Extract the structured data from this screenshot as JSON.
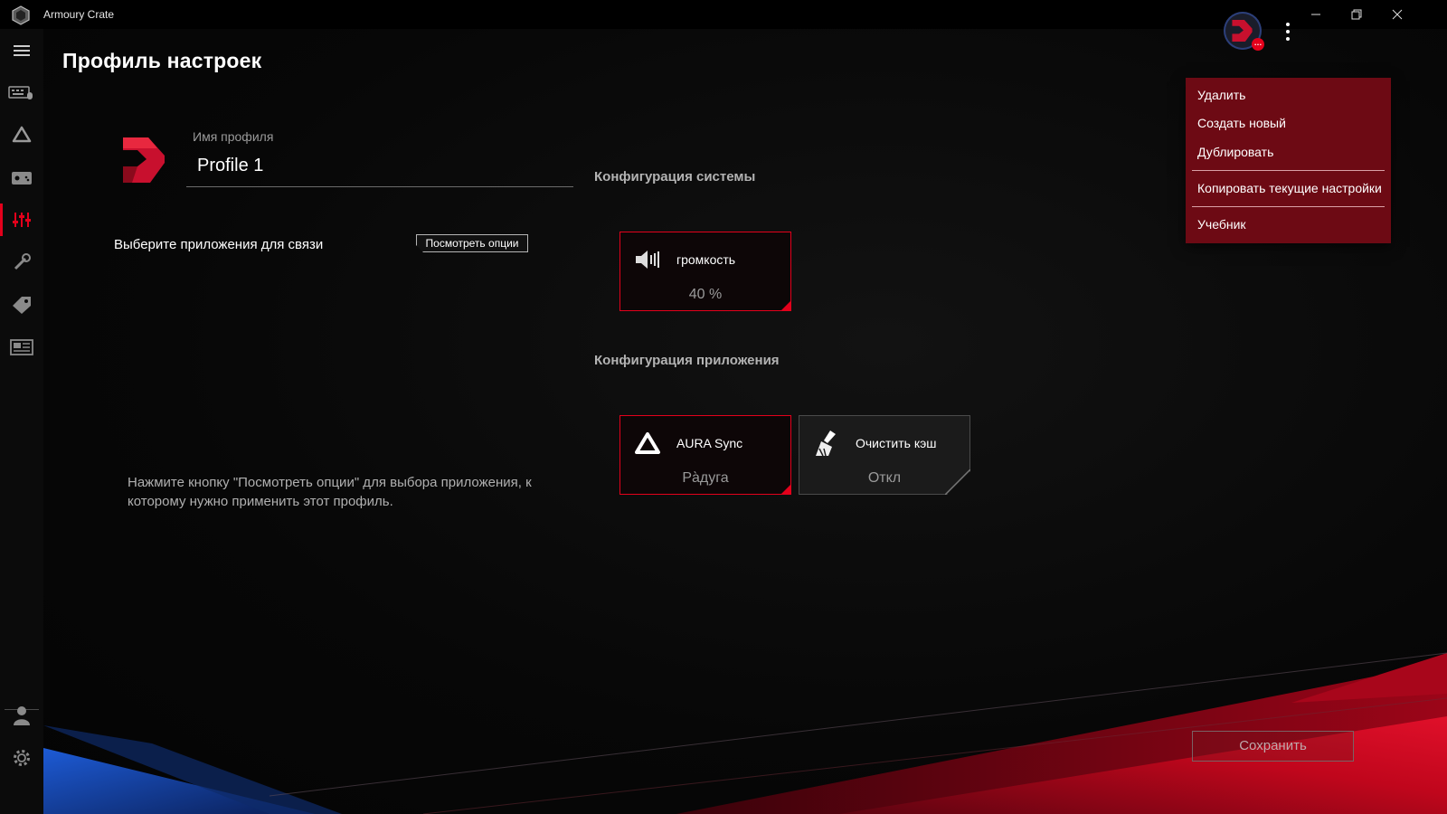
{
  "window": {
    "title": "Armoury Crate"
  },
  "sidebar": {
    "items": [
      {
        "icon": "menu-icon"
      },
      {
        "icon": "keyboard-device-icon"
      },
      {
        "icon": "aura-icon"
      },
      {
        "icon": "gamepad-icon"
      },
      {
        "icon": "scenario-profiles-icon",
        "active": true
      },
      {
        "icon": "tools-icon"
      },
      {
        "icon": "deals-tag-icon"
      },
      {
        "icon": "news-icon"
      },
      {
        "icon": "user-icon"
      },
      {
        "icon": "settings-gear-icon"
      }
    ]
  },
  "page": {
    "title": "Профиль настроек"
  },
  "profile": {
    "name_label": "Имя профиля",
    "name_value": "Profile 1"
  },
  "link": {
    "label": "Выберите приложения для связи",
    "button": "Посмотреть опции",
    "hint": "Нажмите кнопку \"Посмотреть опции\" для выбора приложения, к которому нужно применить этот профиль."
  },
  "system_config": {
    "title": "Конфигурация системы",
    "tiles": [
      {
        "label": "громкость",
        "value": "40 %"
      }
    ]
  },
  "app_config": {
    "title": "Конфигурация приложения",
    "tiles": [
      {
        "label": "AURA Sync",
        "value": "Pа̀дуга"
      },
      {
        "label": "Очистить кэш",
        "value": "Откл"
      }
    ]
  },
  "menu": {
    "items": [
      "Удалить",
      "Создать новый",
      "Дублировать",
      "Копировать текущие настройки",
      "Учебник"
    ]
  },
  "footer": {
    "save": "Сохранить"
  },
  "colors": {
    "accent": "#e3001b",
    "menu_bg": "#6d0a14",
    "background": "#000000"
  }
}
